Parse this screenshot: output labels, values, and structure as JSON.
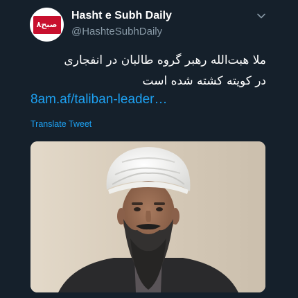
{
  "tweet": {
    "display_name": "Hasht e Subh Daily",
    "handle": "@HashteSubhDaily",
    "avatar_logo_text": "۸صبح",
    "text_lines": [
      "ملا هبت‌الله رهبر گروه طالبان در انفجاری",
      "در کویته کشته شده است"
    ],
    "link": "8am.af/taliban-leader…",
    "translate": "Translate Tweet",
    "caret_icon": "chevron-down-icon",
    "media_icon": "photo"
  },
  "colors": {
    "background": "#15202b",
    "text": "#ffffff",
    "secondary": "#8899a6",
    "accent": "#1da1f2",
    "logo": "#c8102e"
  }
}
